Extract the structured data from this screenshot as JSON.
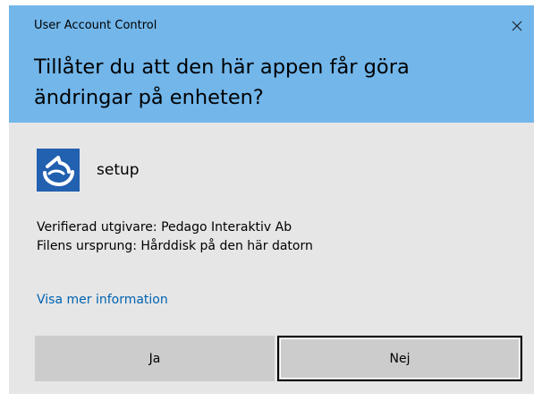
{
  "window": {
    "title": "User Account Control",
    "close_icon": "close-icon"
  },
  "prompt": {
    "question": "Tillåter du att den här appen får göra ändringar på enheten?"
  },
  "app": {
    "icon": "setup-app-icon",
    "name": "setup"
  },
  "details": {
    "publisher": "Verifierad utgivare: Pedago Interaktiv Ab",
    "origin": "Filens ursprung: Hårddisk på den här datorn",
    "more_info_link": "Visa mer information"
  },
  "buttons": {
    "yes_label": "Ja",
    "no_label": "Nej"
  },
  "colors": {
    "header_bg": "#72b6ea",
    "body_bg": "#e6e6e6",
    "button_bg": "#cccccc",
    "link": "#0063b1",
    "app_icon_bg": "#1e5aa8"
  }
}
